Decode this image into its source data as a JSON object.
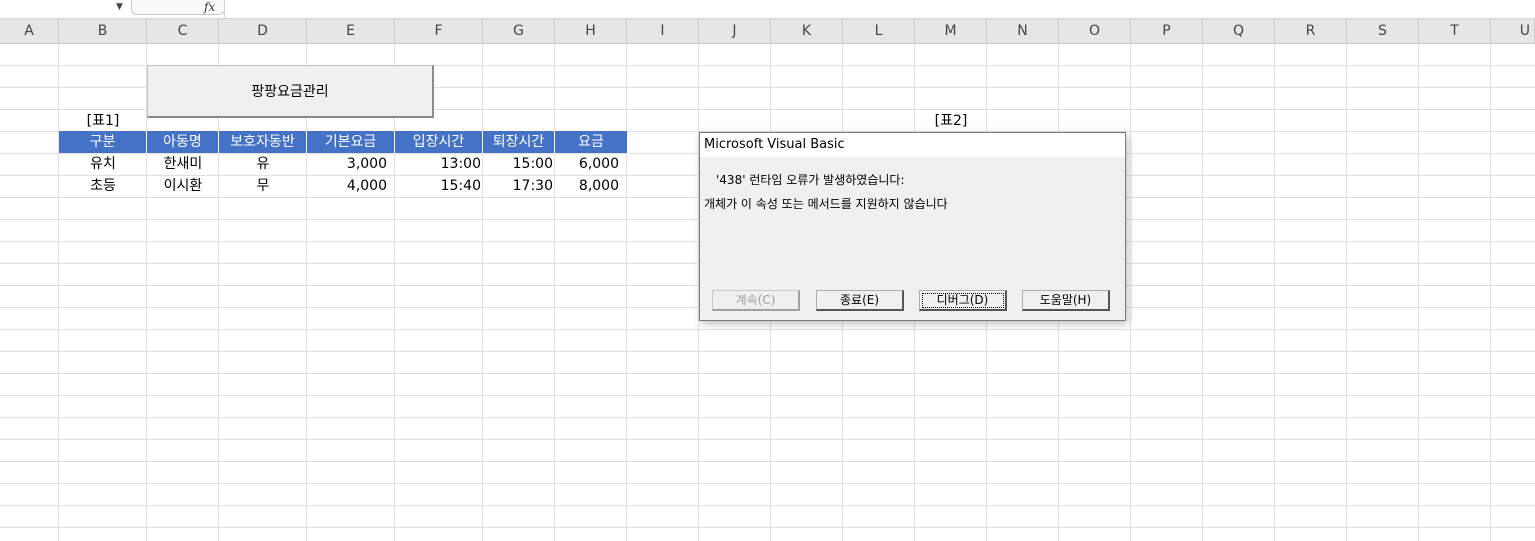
{
  "formula_bar": {
    "fx_label": "fx"
  },
  "columns": [
    "A",
    "B",
    "C",
    "D",
    "E",
    "F",
    "G",
    "H",
    "I",
    "J",
    "K",
    "L",
    "M",
    "N",
    "O",
    "P",
    "Q",
    "R",
    "S",
    "T",
    "U"
  ],
  "macro_button": {
    "label": "팡팡요금관리"
  },
  "table1": {
    "label": "[표1]",
    "headers": [
      "구분",
      "아동명",
      "보호자동반",
      "기본요금",
      "입장시간",
      "퇴장시간",
      "요금"
    ],
    "rows": [
      [
        "유치",
        "한새미",
        "유",
        "3,000",
        "13:00",
        "15:00",
        "6,000"
      ],
      [
        "초등",
        "이시환",
        "무",
        "4,000",
        "15:40",
        "17:30",
        "8,000"
      ]
    ]
  },
  "table2": {
    "label": "[표2]"
  },
  "dialog": {
    "title": "Microsoft Visual Basic",
    "message_line1": "'438' 런타임 오류가 발생하였습니다:",
    "message_line2": "개체가 이 속성 또는 메서드를 지원하지 않습니다",
    "buttons": {
      "continue": "계속(C)",
      "end": "종료(E)",
      "debug": "디버그(D)",
      "help": "도움말(H)"
    }
  },
  "colors": {
    "table_header_bg": "#4472c4",
    "table_header_text": "#ffffff",
    "header_row_bg": "#e6e6e6"
  }
}
